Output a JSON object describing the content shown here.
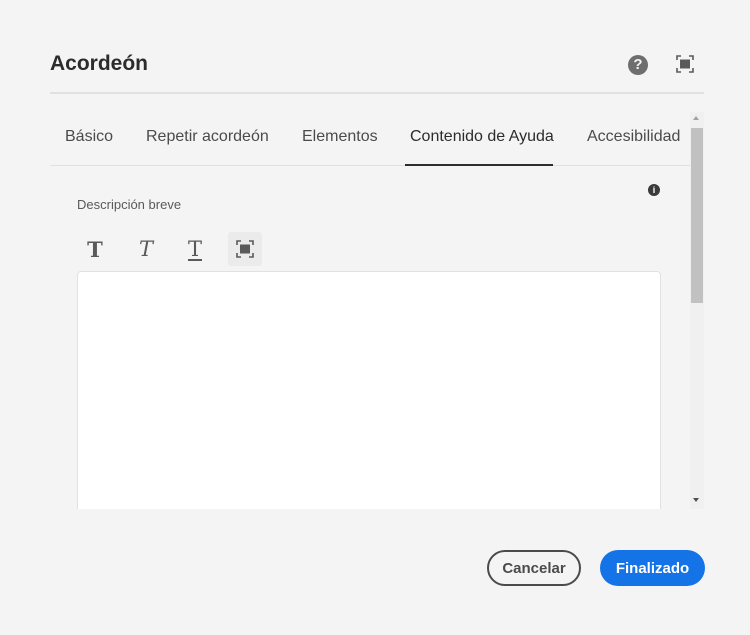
{
  "dialog": {
    "title": "Acordeón",
    "help_icon": "?",
    "tabs": [
      {
        "label": "Básico"
      },
      {
        "label": "Repetir acordeón"
      },
      {
        "label": "Elementos"
      },
      {
        "label": "Contenido de Ayuda",
        "active": true
      },
      {
        "label": "Accesibilidad"
      }
    ],
    "field": {
      "label": "Descripción breve",
      "info_icon": "i",
      "value": ""
    },
    "toolbar": {
      "bold": "T",
      "italic": "T",
      "underline": "T"
    },
    "buttons": {
      "cancel": "Cancelar",
      "done": "Finalizado"
    },
    "colors": {
      "primary": "#1473e6",
      "background": "#f4f4f4"
    }
  }
}
